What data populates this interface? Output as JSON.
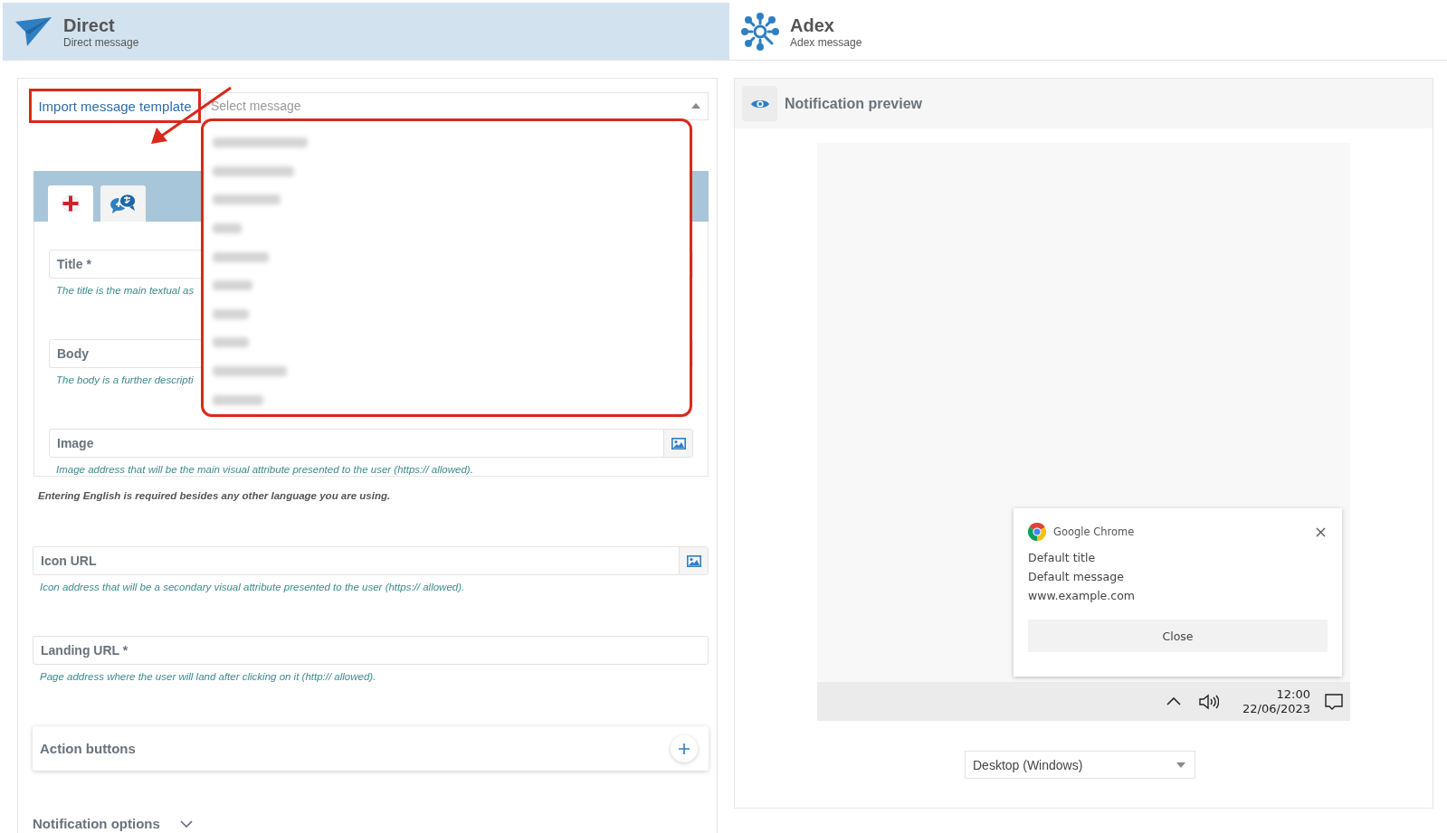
{
  "tabs": [
    {
      "title": "Direct",
      "subtitle": "Direct message",
      "selected": true
    },
    {
      "title": "Adex",
      "subtitle": "Adex message",
      "selected": false
    }
  ],
  "template_import": {
    "button": "Import message template",
    "button_highlighted": true,
    "select_placeholder": "Select message",
    "expanded": true,
    "list_highlighted": true,
    "options": [
      {
        "kind": "blurred"
      },
      {
        "kind": "blurred"
      },
      {
        "kind": "blurred"
      },
      {
        "kind": "blurred"
      },
      {
        "kind": "blurred"
      },
      {
        "kind": "blurred"
      },
      {
        "kind": "blurred"
      },
      {
        "kind": "blurred"
      },
      {
        "kind": "blurred"
      },
      {
        "kind": "blurred"
      }
    ]
  },
  "annotation_arrow": true,
  "language_tabs": [
    {
      "kind": "flag",
      "selected": true
    },
    {
      "kind": "translate",
      "selected": false
    }
  ],
  "fields": [
    {
      "label": "Title *",
      "hint": "The title is the main textual as"
    },
    {
      "label": "Body",
      "hint": "The body is a further descripti"
    },
    {
      "label": "Image",
      "hint": "Image address that will be the main visual attribute presented to the user (https:// allowed).",
      "image_button": true
    }
  ],
  "language_note": "Entering English is required besides any other language you are using.",
  "url_fields": [
    {
      "label": "Icon URL",
      "hint": "Icon address that will be a secondary visual attribute presented to the user (https:// allowed).",
      "image_button": true
    },
    {
      "label": "Landing URL *",
      "hint": "Page address where the user will land after clicking on it (http:// allowed).",
      "image_button": false
    }
  ],
  "action_buttons": {
    "title": "Action buttons"
  },
  "notification_options": {
    "title": "Notification options",
    "expanded": false
  },
  "preview": {
    "title": "Notification preview",
    "notification": {
      "app": "Google Chrome",
      "title": "Default title",
      "message": "Default message",
      "url": "www.example.com",
      "button": "Close"
    },
    "taskbar": {
      "time": "12:00",
      "date": "22/06/2023"
    },
    "device": "Desktop (Windows)"
  }
}
